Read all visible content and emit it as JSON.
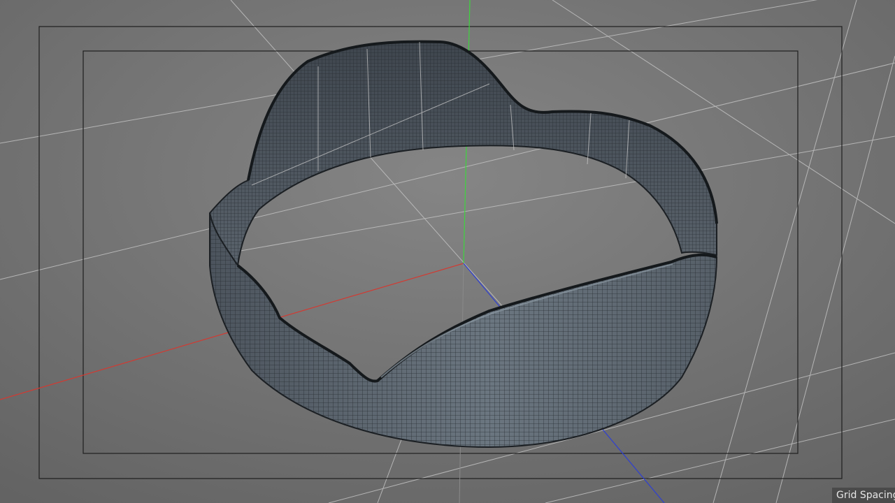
{
  "viewport": {
    "grid_label": "Grid Spacing",
    "colors": {
      "background": "#7a7a7a",
      "grid_line": "#c4c4c4",
      "axis_x": "#d23a32",
      "axis_y": "#3ed43e",
      "axis_z": "#2e3fd2",
      "safe_frame": "#1e1e1e",
      "mesh_fill": "#5d6670",
      "mesh_wire": "#23282e"
    },
    "icons": {
      "object": "lens-hood-mesh"
    }
  }
}
